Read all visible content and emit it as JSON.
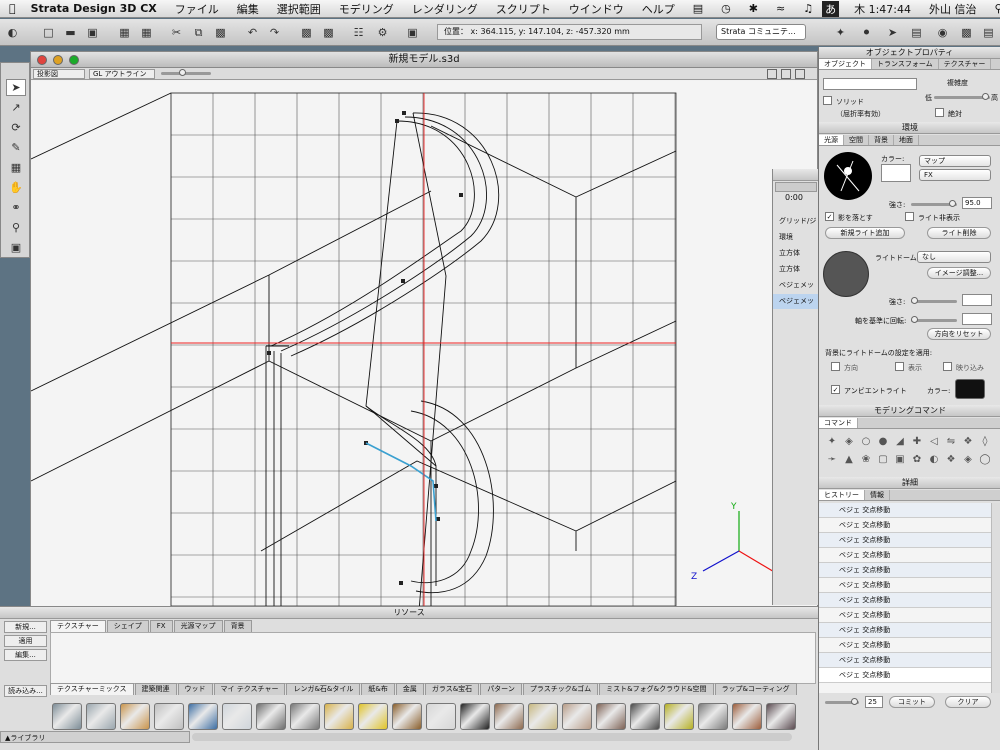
{
  "menubar": {
    "app": "Strata Design 3D CX",
    "items": [
      "ファイル",
      "編集",
      "選択範囲",
      "モデリング",
      "レンダリング",
      "スクリプト",
      "ウインドウ",
      "ヘルプ"
    ],
    "clock": "木 1:47:44",
    "user": "外山 信治",
    "ime": "あ"
  },
  "toolbar": {
    "coords": "位置： x: 364.115, y: 147.104, z: -457.320 mm",
    "community": "Strata コミュニテ..."
  },
  "document": {
    "title": "新規モデル.s3d",
    "view": "投影図",
    "render_mode": "GL アウトライン"
  },
  "object_props": {
    "title": "オブジェクトプロパティ",
    "tabs": [
      "オブジェクト",
      "トランスフォーム",
      "テクスチャー"
    ],
    "solid": "ソリッド",
    "refraction": "（屈折率有効）",
    "complexity": "複雑度",
    "low": "低",
    "high": "高",
    "absolute": "絶対"
  },
  "environment": {
    "title": "環境",
    "tabs": [
      "光源",
      "空間",
      "背景",
      "地面"
    ],
    "color_label": "カラー:",
    "map": "マップ",
    "fx": "FX",
    "strength_label": "強さ:",
    "strength": "95.0",
    "cast_shadow": "影を落とす",
    "light_hidden": "ライト非表示",
    "add_light": "新規ライト追加",
    "delete_light": "ライト削除",
    "light_dome": "ライトドーム:",
    "dome_value": "なし",
    "image_adjust": "イメージ調整...",
    "strength2": "強さ:",
    "axis_rotate": "軸を基準に回転:",
    "reset_dir": "方向をリセット",
    "apply_label": "背景にライトドームの設定を適用:",
    "direction": "方向",
    "display": "表示",
    "reflect": "映り込み",
    "ambient": "アンビエントライト",
    "ambient_color": "カラー:"
  },
  "modeling": {
    "title": "モデリングコマンド",
    "tab": "コマンド"
  },
  "details": {
    "title": "詳細",
    "tabs": [
      "ヒストリー",
      "情報"
    ],
    "history": [
      "ベジェ 交点移動",
      "ベジェ 交点移動",
      "ベジェ 交点移動",
      "ベジェ 交点移動",
      "ベジェ 交点移動",
      "ベジェ 交点移動",
      "ベジェ 交点移動",
      "ベジェ 交点移動",
      "ベジェ 交点移動",
      "ベジェ 交点移動",
      "ベジェ 交点移動",
      "ベジェ 交点移動"
    ],
    "count": "25",
    "commit": "コミット",
    "clear": "クリア"
  },
  "mini_panel": {
    "time": "0:00",
    "items": [
      "グリッド/ジ",
      "環境",
      "立方体",
      "立方体",
      "ベジェメッ",
      "ベジェメッ"
    ]
  },
  "resources": {
    "title": "リソース",
    "tabs": [
      "テクスチャー",
      "シェイプ",
      "FX",
      "光源マップ",
      "背景"
    ],
    "new": "新規...",
    "apply": "適用",
    "edit": "編集...",
    "load": "読み込み...",
    "library": "ライブラリ",
    "lib_tabs": [
      "テクスチャーミックス",
      "建築関連",
      "ウッド",
      "マイ テクスチャー",
      "レンガ&石&タイル",
      "紙&布",
      "金属",
      "ガラス&宝石",
      "パターン",
      "プラスチック&ゴム",
      "ミスト&フォグ&クラウド&空間",
      "ラップ&コーティング"
    ]
  },
  "colors": {
    "swatches": [
      "#7d8d97",
      "#9aa6ae",
      "#c9944b",
      "#bfbfbf",
      "#3d6ea3",
      "#cfd5db",
      "#6e6e6e",
      "#777777",
      "#d8b24a",
      "#e0c326",
      "#8a5f2c",
      "#d6d6d6",
      "#222222",
      "#8d6a4f",
      "#c7b77f",
      "#b89c88",
      "#7d6255",
      "#4a4a4a",
      "#b6b023",
      "#7a7a7a",
      "#9d5e3c",
      "#5a4a50"
    ]
  }
}
